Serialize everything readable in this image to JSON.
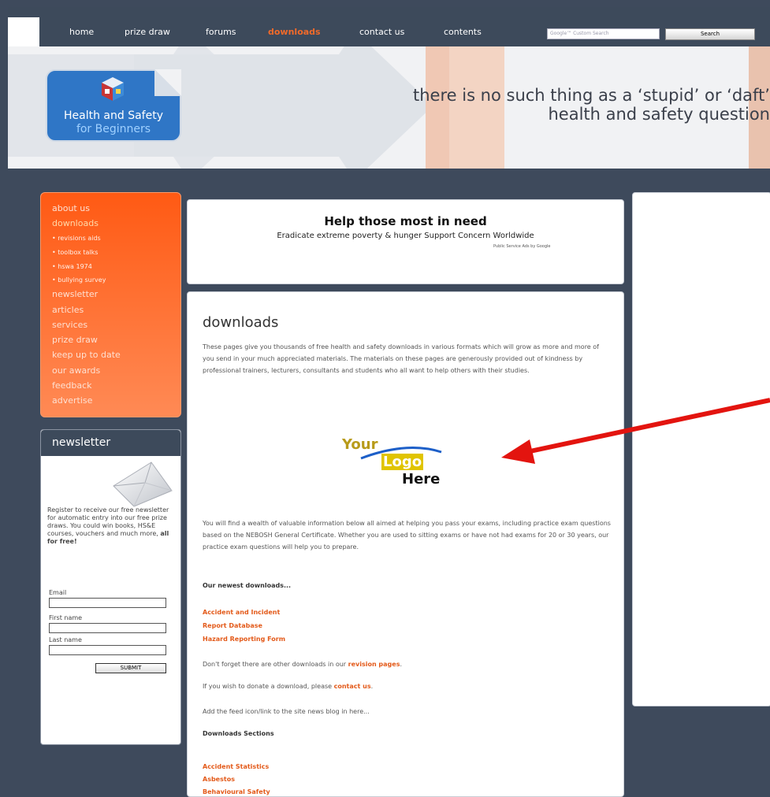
{
  "nav": {
    "items": [
      "home",
      "prize draw",
      "forums",
      "downloads",
      "contact us",
      "contents"
    ],
    "active": "downloads",
    "search_placeholder": "Google™ Custom Search",
    "search_button": "Search"
  },
  "header": {
    "logo_line1": "Health and Safety",
    "logo_line2": "for Beginners",
    "tagline_line1": "there is no such thing as a ‘stupid’ or ‘daft’",
    "tagline_line2": "health and safety question"
  },
  "sidebar": {
    "items": [
      {
        "label": "about us",
        "type": "main"
      },
      {
        "label": "downloads",
        "type": "main"
      },
      {
        "label": "• revisions aids",
        "type": "sub"
      },
      {
        "label": "• toolbox talks",
        "type": "sub"
      },
      {
        "label": "• hswa 1974",
        "type": "sub"
      },
      {
        "label": "• bullying survey",
        "type": "sub"
      },
      {
        "label": "newsletter",
        "type": "main"
      },
      {
        "label": "articles",
        "type": "main"
      },
      {
        "label": "services",
        "type": "main"
      },
      {
        "label": "prize draw",
        "type": "main"
      },
      {
        "label": "keep up to date",
        "type": "main"
      },
      {
        "label": "our awards",
        "type": "main"
      },
      {
        "label": "feedback",
        "type": "main"
      },
      {
        "label": "advertise",
        "type": "main"
      }
    ]
  },
  "newsletter": {
    "title": "newsletter",
    "text": "Register to receive our free newsletter for automatic entry into our free prize draws. You could win books, HS&E courses, vouchers and much more,",
    "text_bold": "all for free!",
    "email_label": "Email",
    "first_name_label": "First name",
    "last_name_label": "Last name",
    "submit_label": "SUBMIT"
  },
  "ad": {
    "title": "Help those most in need",
    "subtitle": "Eradicate extreme poverty & hunger Support Concern Worldwide",
    "small": "Public Service Ads by Google"
  },
  "main": {
    "title": "downloads",
    "intro": "These pages give you thousands of free health and safety downloads in various formats which will grow as more and more of you send in your much appreciated materials. The materials on these pages are generously provided out of kindness by professional trainers, lecturers, consultants and students who all want to help others with their studies.",
    "logo_your": "Your",
    "logo_logo": "Logo",
    "logo_here": "Here",
    "para2": "You will find a wealth of valuable information below all aimed at helping you pass your exams, including practice exam questions based on the NEBOSH General Certificate. Whether you are used to sitting exams or have not had exams for 20 or 30 years, our practice exam questions will help you to prepare.",
    "newest_heading": "Our newest downloads...",
    "newest_links": [
      "Accident and Incident",
      "Report Database",
      "Hazard Reporting Form"
    ],
    "revision_text": "Don't forget there are other downloads in our",
    "revision_link": "revision pages",
    "donate_text": "If you wish to donate a download, please",
    "donate_link": "contact us",
    "feed_text": "Add the feed icon/link to the site news blog in here...",
    "sections_heading": "Downloads Sections",
    "section_links": [
      "Accident Statistics",
      "Asbestos",
      "Behavioural Safety"
    ]
  },
  "colors": {
    "accent_orange": "#f26a2a",
    "nav_bg": "#3d4a5b",
    "logo_blue": "#2f76c6",
    "annotation_red": "#e3140f"
  }
}
